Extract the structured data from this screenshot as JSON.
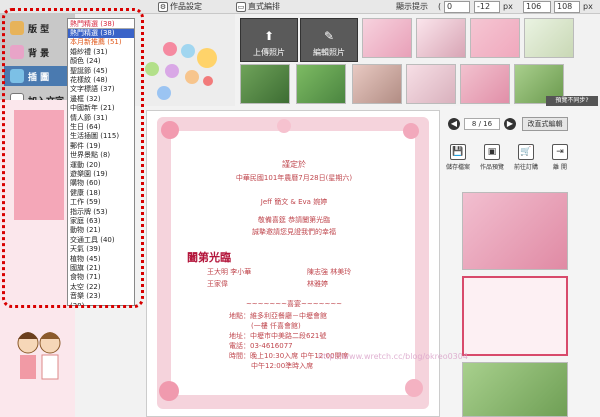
{
  "toolbar": {
    "design_label": "作品設定",
    "edit_label": "直式編排",
    "show_hint_label": "顯示提示",
    "x_value": "0",
    "y_value": "-12",
    "unit_px": "px",
    "w_value": "106",
    "h_value": "108",
    "unit_px2": "px"
  },
  "left_menu": {
    "items": [
      {
        "label": "版 型"
      },
      {
        "label": "背 景"
      },
      {
        "label": "插 圖"
      },
      {
        "label": "加入文字"
      }
    ]
  },
  "dropdown": {
    "selected": "熱門精選 (38)",
    "options": [
      "熱門精選 (38)",
      "本月新推薦 (51)",
      "婚紗禮 (31)",
      "顏色 (24)",
      "聖誕節 (45)",
      "花樣紋 (48)",
      "文字標語 (37)",
      "邊框 (32)",
      "中國新年 (21)",
      "情人節 (31)",
      "生日 (64)",
      "生活插圖 (115)",
      "郵件 (19)",
      "世界景點 (8)",
      "運動 (20)",
      "遊樂園 (19)",
      "購物 (60)",
      "健康 (18)",
      "工作 (59)",
      "指示牌 (53)",
      "家庭 (63)",
      "動物 (21)",
      "交通工具 (40)",
      "天氣 (39)",
      "植物 (45)",
      "國旗 (21)",
      "食物 (71)",
      "太空 (22)",
      "音樂 (23)",
      "(28)"
    ]
  },
  "actions": {
    "upload_label": "上傳照片",
    "edit_photo_label": "編輯照片",
    "preview_label": "預覽不同步?"
  },
  "pager": {
    "page": "8 / 16",
    "edit_label": "改直式編輯"
  },
  "right_buttons": [
    {
      "label": "儲存檔案"
    },
    {
      "label": "作品預覽"
    },
    {
      "label": "前往訂購"
    },
    {
      "label": "離 開"
    }
  ],
  "card": {
    "heading": "謹定於",
    "date_line": "中華民國101年農曆7月28日(星期六)",
    "couple": "Jeff 簡文 & Eva 婉婷",
    "invite_line1": "敬備喜筵 恭請闔第光臨",
    "invite_line2": "誠摯邀請您見證我們的幸福",
    "banner": "闔第光臨",
    "parents_left": "王大明   李小華",
    "parents_right": "陳志強   林美玲",
    "host_left": "王家偉",
    "host_right": "林雅婷",
    "divider": "~~~~~~~喜宴~~~~~~~",
    "venue_line": "地點：維多利亞餐廳－中壢會館",
    "venue_sub": "(一樓 仟喜會館)",
    "address_line": "地址：中壢市中美路二段621號",
    "phone_line": "電話：03-4616077",
    "time_line1": "時間：晚上10:30入席 中午12:00開席",
    "time_line2": "中午12:00準時入席"
  },
  "watermark": "http://www.wretch.cc/blog/okreo0304"
}
